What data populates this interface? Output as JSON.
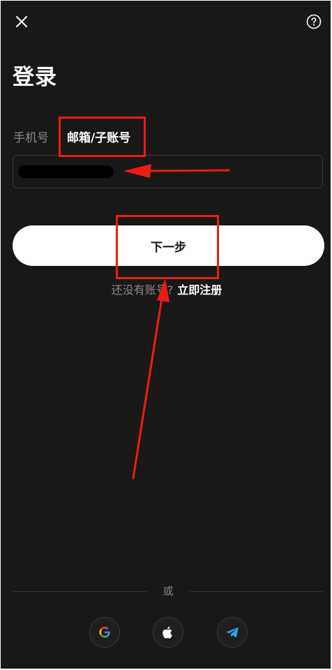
{
  "header": {
    "close_icon": "close-icon",
    "help_icon": "question-circle-icon"
  },
  "page": {
    "title": "登录"
  },
  "tabs": {
    "phone_label": "手机号",
    "email_label": "邮箱/子账号",
    "active": "email"
  },
  "form": {
    "account_value": ""
  },
  "actions": {
    "next_label": "下一步"
  },
  "register": {
    "prompt": "还没有账号?",
    "link_label": "立即注册"
  },
  "divider": {
    "label": "或"
  },
  "social": {
    "google_icon": "google-icon",
    "apple_icon": "apple-icon",
    "telegram_icon": "telegram-icon"
  },
  "colors": {
    "background": "#181818",
    "primary_button": "#ffffff",
    "annotation": "#ec1c10",
    "muted_text": "#8a8a8a"
  }
}
